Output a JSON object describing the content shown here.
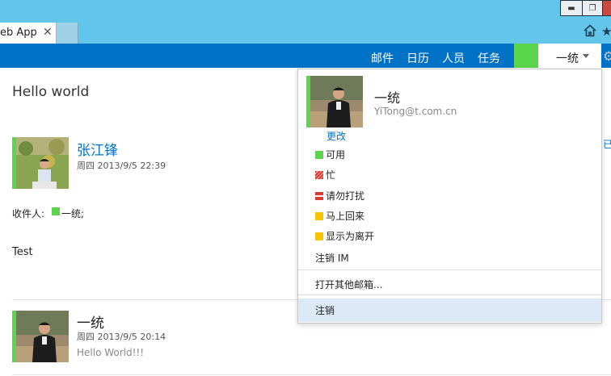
{
  "browser": {
    "tab_title": "eb App",
    "tab_close": "✕",
    "window_min": "▬",
    "window_max": "❐",
    "home_icon": "home-icon",
    "star_icon": "★"
  },
  "header": {
    "nav": [
      "邮件",
      "日历",
      "人员",
      "任务"
    ],
    "user_name": "一统",
    "presence_color": "#5bd54b",
    "bar_color": "#0072c6",
    "gear_glyph": "⚙"
  },
  "conversation": {
    "title": "Hello world",
    "messages": [
      {
        "sender": "张江锋",
        "time": "周四 2013/9/5 22:39",
        "recipients_label": "收件人:",
        "recipient": "一统;",
        "body": "Test"
      },
      {
        "sender": "一统",
        "time": "周四 2013/9/5 20:14",
        "preview": "Hello World!!!"
      }
    ],
    "cut_text": "已"
  },
  "user_menu": {
    "name": "一统",
    "email": "YiTong@t.com.cn",
    "change_link": "更改",
    "statuses": [
      {
        "label": "可用",
        "state": "available",
        "color": "#5bd54b"
      },
      {
        "label": "忙",
        "state": "busy",
        "color": "#d93a32"
      },
      {
        "label": "请勿打扰",
        "state": "do-not-disturb",
        "color": "#d93a32"
      },
      {
        "label": "马上回来",
        "state": "be-right-back",
        "color": "#f6c600"
      },
      {
        "label": "显示为离开",
        "state": "away",
        "color": "#f6c600"
      }
    ],
    "sign_out_im": "注销 IM",
    "open_other_mailbox": "打开其他邮箱...",
    "sign_out": "注销"
  }
}
